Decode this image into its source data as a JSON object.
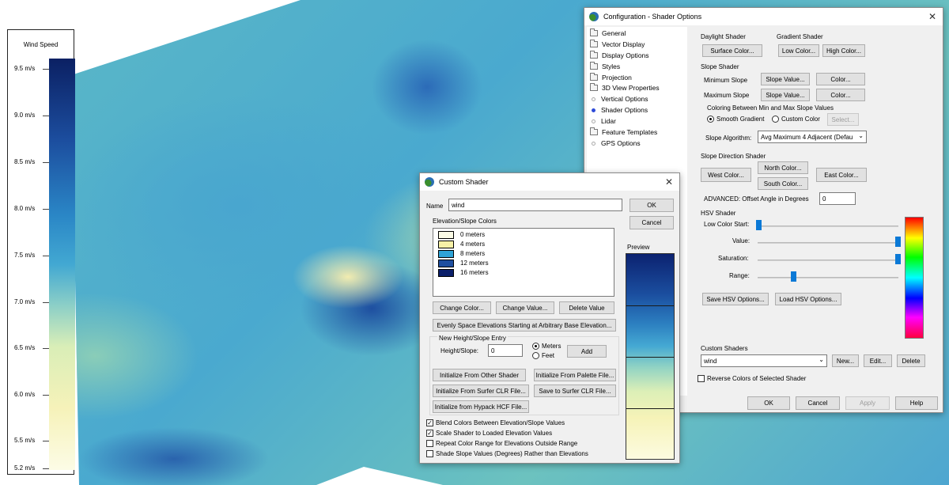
{
  "legend": {
    "title": "Wind Speed",
    "ticks": [
      "9.5 m/s",
      "9.0 m/s",
      "8.5 m/s",
      "8.0 m/s",
      "7.5 m/s",
      "7.0 m/s",
      "6.5 m/s",
      "6.0 m/s",
      "5.5 m/s",
      "5.2 m/s"
    ]
  },
  "config": {
    "title": "Configuration - Shader Options",
    "tree": [
      {
        "label": "General",
        "icon": "folder-icon"
      },
      {
        "label": "Vector Display",
        "icon": "folder-icon"
      },
      {
        "label": "Display Options",
        "icon": "folder-icon"
      },
      {
        "label": "Styles",
        "icon": "folder-icon"
      },
      {
        "label": "Projection",
        "icon": "folder-icon"
      },
      {
        "label": "3D View Properties",
        "icon": "folder-icon"
      },
      {
        "label": "Vertical Options",
        "icon": "dot-icon"
      },
      {
        "label": "Shader Options",
        "icon": "dot-icon"
      },
      {
        "label": "Lidar",
        "icon": "dot-icon"
      },
      {
        "label": "Feature Templates",
        "icon": "folder-icon"
      },
      {
        "label": "GPS Options",
        "icon": "dot-icon"
      }
    ],
    "daylight_label": "Daylight Shader",
    "surface_color": "Surface Color...",
    "gradient_label": "Gradient Shader",
    "low_color": "Low Color...",
    "high_color": "High Color...",
    "slope_label": "Slope Shader",
    "min_slope": "Minimum Slope",
    "max_slope": "Maximum Slope",
    "slope_value": "Slope Value...",
    "color_btn": "Color...",
    "coloring_between": "Coloring Between Min and Max Slope Values",
    "smooth_gradient": "Smooth Gradient",
    "custom_color": "Custom Color",
    "select_btn": "Select...",
    "slope_algorithm_label": "Slope Algorithm:",
    "slope_algorithm_value": "Avg Maximum 4 Adjacent (Defau",
    "slope_direction_label": "Slope Direction Shader",
    "north_color": "North Color...",
    "south_color": "South Color...",
    "west_color": "West Color...",
    "east_color": "East Color...",
    "offset_label": "ADVANCED: Offset Angle in Degrees",
    "offset_value": "0",
    "hsv_label": "HSV Shader",
    "low_color_start": "Low Color Start:",
    "value_label": "Value:",
    "saturation_label": "Saturation:",
    "range_label": "Range:",
    "save_hsv": "Save HSV Options...",
    "load_hsv": "Load HSV Options...",
    "custom_shaders_label": "Custom Shaders",
    "custom_shader_value": "wind",
    "new_btn": "New...",
    "edit_btn": "Edit...",
    "delete_btn": "Delete",
    "reverse_colors": "Reverse Colors of Selected Shader",
    "ok": "OK",
    "cancel": "Cancel",
    "apply": "Apply",
    "help": "Help"
  },
  "shader": {
    "title": "Custom Shader",
    "name_label": "Name",
    "name_value": "wind",
    "ok": "OK",
    "cancel": "Cancel",
    "colors_label": "Elevation/Slope Colors",
    "colors": [
      {
        "label": "0 meters",
        "color": "#fbfbe6"
      },
      {
        "label": "4 meters",
        "color": "#f7f1a7"
      },
      {
        "label": "8 meters",
        "color": "#2fa3d6"
      },
      {
        "label": "12 meters",
        "color": "#1f4fa0"
      },
      {
        "label": "16 meters",
        "color": "#0b1f6a"
      }
    ],
    "preview_label": "Preview",
    "change_color": "Change Color...",
    "change_value": "Change Value...",
    "delete_value": "Delete Value",
    "evenly_space": "Evenly Space Elevations Starting at Arbitrary Base Elevation...",
    "new_entry_label": "New Height/Slope Entry",
    "height_slope_label": "Height/Slope:",
    "height_slope_value": "0",
    "meters": "Meters",
    "feet": "Feet",
    "add": "Add",
    "init_other": "Initialize From Other Shader",
    "init_palette": "Initialize From Palette File...",
    "init_surfer": "Initialize From Surfer CLR File...",
    "save_surfer": "Save to Surfer CLR File...",
    "init_hypack": "Initialize from Hypack HCF File...",
    "blend_colors": "Blend Colors Between Elevation/Slope Values",
    "scale_shader": "Scale Shader to Loaded Elevation Values",
    "repeat_range": "Repeat Color Range for Elevations Outside Range",
    "shade_slope": "Shade Slope Values (Degrees) Rather than Elevations",
    "blend_checked": true,
    "scale_checked": true,
    "repeat_checked": false,
    "shade_checked": false
  }
}
